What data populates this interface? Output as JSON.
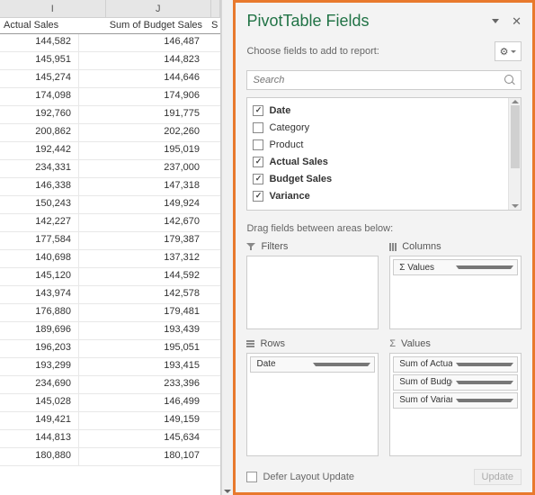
{
  "columns": {
    "letters": [
      "I",
      "J"
    ],
    "headers": [
      "Actual Sales",
      "Sum of Budget Sales",
      "S"
    ]
  },
  "rows": [
    {
      "a": "144,582",
      "b": "146,487"
    },
    {
      "a": "145,951",
      "b": "144,823"
    },
    {
      "a": "145,274",
      "b": "144,646"
    },
    {
      "a": "174,098",
      "b": "174,906"
    },
    {
      "a": "192,760",
      "b": "191,775"
    },
    {
      "a": "200,862",
      "b": "202,260"
    },
    {
      "a": "192,442",
      "b": "195,019"
    },
    {
      "a": "234,331",
      "b": "237,000"
    },
    {
      "a": "146,338",
      "b": "147,318"
    },
    {
      "a": "150,243",
      "b": "149,924"
    },
    {
      "a": "142,227",
      "b": "142,670"
    },
    {
      "a": "177,584",
      "b": "179,387"
    },
    {
      "a": "140,698",
      "b": "137,312"
    },
    {
      "a": "145,120",
      "b": "144,592"
    },
    {
      "a": "143,974",
      "b": "142,578"
    },
    {
      "a": "176,880",
      "b": "179,481"
    },
    {
      "a": "189,696",
      "b": "193,439"
    },
    {
      "a": "196,203",
      "b": "195,051"
    },
    {
      "a": "193,299",
      "b": "193,415"
    },
    {
      "a": "234,690",
      "b": "233,396"
    },
    {
      "a": "145,028",
      "b": "146,499"
    },
    {
      "a": "149,421",
      "b": "149,159"
    },
    {
      "a": "144,813",
      "b": "145,634"
    },
    {
      "a": "180,880",
      "b": "180,107"
    }
  ],
  "panel": {
    "title": "PivotTable Fields",
    "choose": "Choose fields to add to report:",
    "search_placeholder": "Search",
    "drag": "Drag fields between areas below:",
    "defer": "Defer Layout Update",
    "update": "Update"
  },
  "fields": [
    {
      "label": "Date",
      "checked": true,
      "bold": true
    },
    {
      "label": "Category",
      "checked": false,
      "bold": false
    },
    {
      "label": "Product",
      "checked": false,
      "bold": false
    },
    {
      "label": "Actual Sales",
      "checked": true,
      "bold": true
    },
    {
      "label": "Budget Sales",
      "checked": true,
      "bold": true
    },
    {
      "label": "Variance",
      "checked": true,
      "bold": true
    }
  ],
  "areas": {
    "filters": {
      "label": "Filters",
      "items": []
    },
    "columns": {
      "label": "Columns",
      "items": [
        "Σ Values"
      ]
    },
    "rows": {
      "label": "Rows",
      "items": [
        "Date"
      ]
    },
    "values": {
      "label": "Values",
      "items": [
        "Sum of Actual Sales",
        "Sum of Budget Sales",
        "Sum of Variance"
      ]
    }
  }
}
